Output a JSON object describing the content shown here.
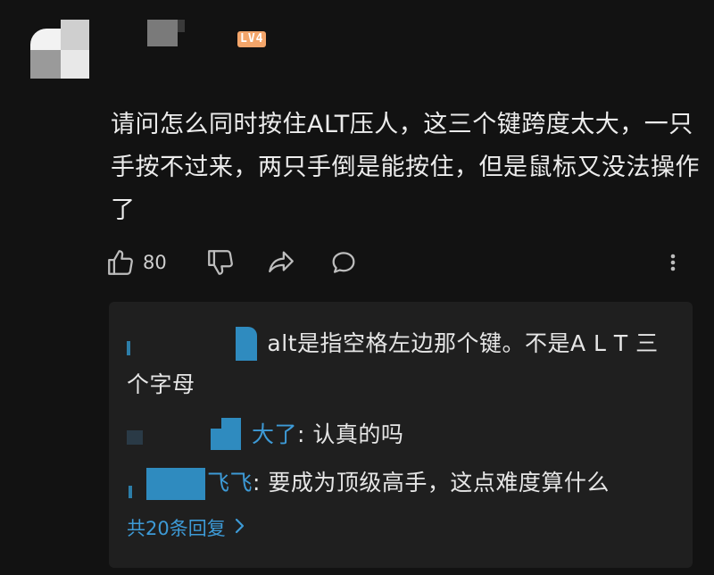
{
  "comment": {
    "level": "LV4",
    "text": "请问怎么同时按住ALT压人，这三个键跨度太大，一只手按不过来，两只手倒是能按住，但是鼠标又没法操作了",
    "likes": "80"
  },
  "icons": {
    "like": "thumbs-up-icon",
    "dislike": "thumbs-down-icon",
    "share": "share-icon",
    "reply": "comment-bubble-icon",
    "more": "more-vertical-icon",
    "chevron": "chevron-right-icon"
  },
  "replies": [
    {
      "name": "",
      "text": ": alt是指空格左边那个键。不是A L T 三个字母"
    },
    {
      "name": "大了",
      "text": ": 认真的吗"
    },
    {
      "name": "飞飞",
      "text": ": 要成为顶级高手，这点难度算什么"
    }
  ],
  "more_replies_label": "共20条回复",
  "colors": {
    "background": "#121212",
    "panel": "#1f1f1f",
    "link": "#3d9ad6",
    "level_badge": "#f3a56a"
  }
}
